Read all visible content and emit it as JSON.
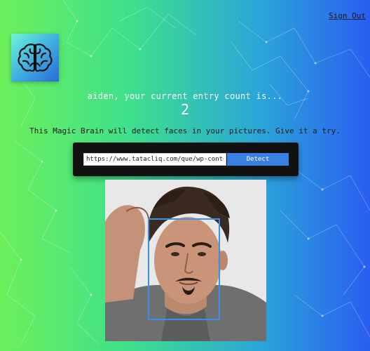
{
  "nav": {
    "sign_out": "Sign Out"
  },
  "logo": {
    "icon": "brain-icon"
  },
  "rank": {
    "message": "aiden, your current entry count is...",
    "count": "2"
  },
  "description": "This Magic Brain will detect faces in your pictures. Give it a try.",
  "form": {
    "url_value": "https://www.tatacliq.com/que/wp-content",
    "button_label": "Detect"
  },
  "colors": {
    "gradient_left": "#6cf05a",
    "gradient_right": "#2a5ef0",
    "panel": "#111111",
    "button": "#3a7fe2",
    "face_box": "#3a8fe8"
  }
}
